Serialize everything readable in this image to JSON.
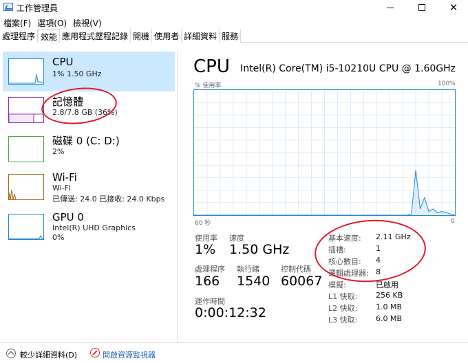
{
  "window": {
    "title": "工作管理員"
  },
  "menu": [
    "檔案(F)",
    "選項(O)",
    "檢視(V)"
  ],
  "tabs": [
    "處理程序",
    "效能",
    "應用程式歷程記錄",
    "開機",
    "使用者",
    "詳細資料",
    "服務"
  ],
  "active_tab": 1,
  "sidebar": [
    {
      "title": "CPU",
      "line1": "1% 1.50 GHz",
      "line2": "",
      "color": "#1d88d6",
      "selected": true
    },
    {
      "title": "記憶體",
      "line1": "2.8/7.8 GB (36%)",
      "line2": "",
      "color": "#8b2ec0",
      "selected": false
    },
    {
      "title": "磁碟 0 (C: D:)",
      "line1": "2%",
      "line2": "",
      "color": "#4fa83d",
      "selected": false
    },
    {
      "title": "Wi-Fi",
      "line1": "Wi-Fi",
      "line2": "已傳送: 24.0  已接收: 24.0 Kbps",
      "color": "#a9661e",
      "selected": false
    },
    {
      "title": "GPU 0",
      "line1": "Intel(R) UHD Graphics",
      "line2": "0%",
      "color": "#1d88d6",
      "selected": false
    }
  ],
  "main": {
    "title": "CPU",
    "model": "Intel(R) Core(TM) i5-10210U CPU @ 1.60GHz",
    "graph": {
      "y_label": "% 使用率",
      "y_max_label": "100%",
      "x_left_label": "60 秒",
      "x_right_label": "0",
      "usage_series": [
        0,
        0,
        0,
        0,
        0,
        0,
        0,
        0,
        0,
        0,
        0,
        0,
        0,
        0,
        0,
        0,
        0,
        0,
        0,
        0,
        0,
        0,
        0,
        0,
        0,
        0,
        0,
        0,
        0,
        0,
        0,
        0,
        0,
        0,
        0,
        0,
        0,
        0,
        0,
        0,
        0,
        0,
        0,
        0,
        0,
        0,
        0,
        0,
        0,
        0,
        1,
        36,
        5,
        14,
        3,
        5,
        2,
        3,
        2,
        1,
        0
      ]
    },
    "stats": {
      "utilization_label": "使用率",
      "utilization_value": "1%",
      "speed_label": "速度",
      "speed_value": "1.50 GHz",
      "processes_label": "處理程序",
      "processes_value": "166",
      "threads_label": "執行緒",
      "threads_value": "1540",
      "handles_label": "控制代碼",
      "handles_value": "60067",
      "uptime_label": "運作時間",
      "uptime_value": "0:00:12:32"
    },
    "specs": [
      {
        "label": "基本速度:",
        "value": "2.11 GHz"
      },
      {
        "label": "插槽:",
        "value": "1"
      },
      {
        "label": "核心數目:",
        "value": "4"
      },
      {
        "label": "邏輯處理器:",
        "value": "8"
      },
      {
        "label": "模擬:",
        "value": "已啟用"
      },
      {
        "label": "L1 快取:",
        "value": "256 KB"
      },
      {
        "label": "L2 快取:",
        "value": "1.0 MB"
      },
      {
        "label": "L3 快取:",
        "value": "6.0 MB"
      }
    ]
  },
  "bottom": {
    "fewer_details": "較少詳細資料(D)",
    "resource_monitor": "開啟資源監視器"
  }
}
